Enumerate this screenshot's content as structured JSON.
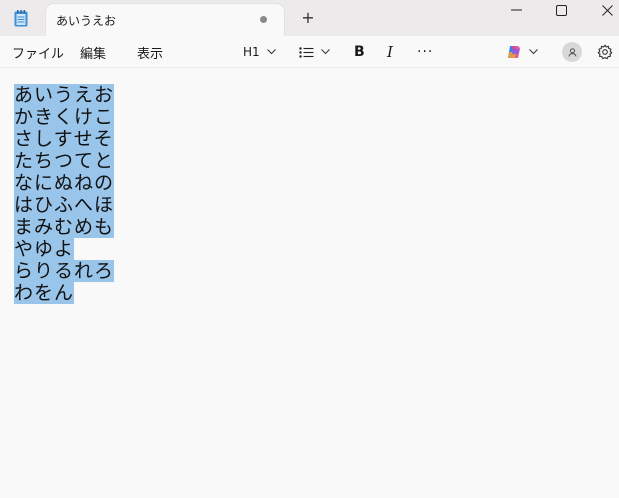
{
  "tab": {
    "title": "あいうえお",
    "new_tab": "+"
  },
  "window_controls": {
    "minimize": "minimize-icon",
    "maximize": "maximize-icon",
    "close": "close-icon"
  },
  "menu": {
    "file": "ファイル",
    "edit": "編集",
    "view": "表示"
  },
  "toolbar": {
    "heading": "H1",
    "bold": "B",
    "italic": "I",
    "more": "···"
  },
  "editor": {
    "lines": [
      "あいうえお",
      "かきくけこ",
      "さしすせそ",
      "たちつてと",
      "なにぬねの",
      "はひふへほ",
      "まみむめも",
      "やゆよ",
      "らりるれろ",
      "わをん"
    ],
    "selection_color": "#99c5ea"
  }
}
